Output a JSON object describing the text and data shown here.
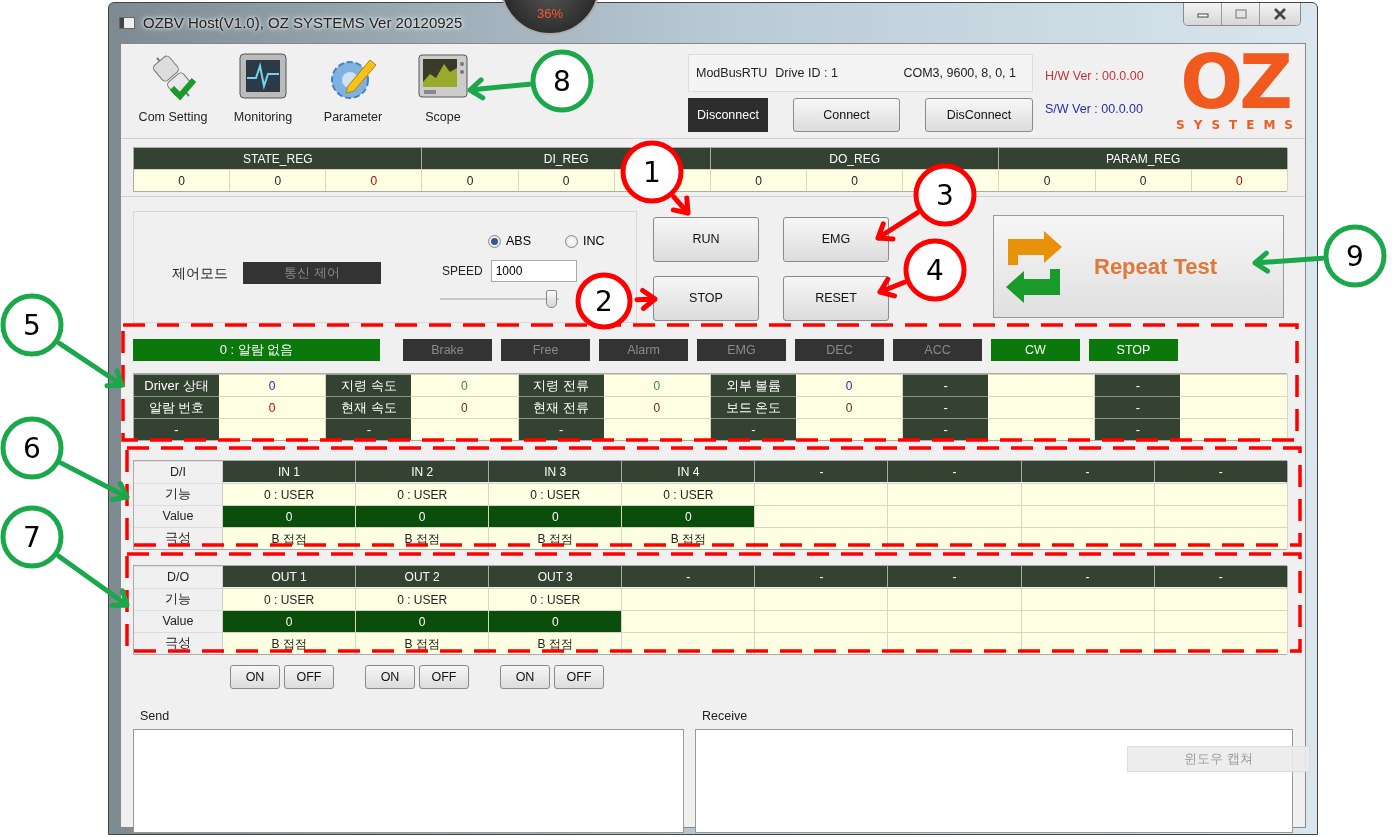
{
  "window": {
    "title": "OZBV Host(V1.0), OZ SYSTEMS Ver 20120925"
  },
  "gauge": {
    "reading": "36%"
  },
  "toolbar": [
    {
      "label": "Com Setting",
      "kind": "plug"
    },
    {
      "label": "Monitoring",
      "kind": "monitor"
    },
    {
      "label": "Parameter",
      "kind": "gear"
    },
    {
      "label": "Scope",
      "kind": "scope"
    }
  ],
  "connection": {
    "protocol": "ModBusRTU",
    "drive_id": "Drive ID : 1",
    "port": "COM3, 9600, 8, 0, 1",
    "status": "Disconnect",
    "buttons": [
      "Connect",
      "DisConnect"
    ]
  },
  "versions": {
    "hw": "H/W Ver : 00.0.00",
    "sw": "S/W Ver : 00.0.00"
  },
  "logo": {
    "mark": "OZ",
    "tagline": "SYSTEMS"
  },
  "registers": [
    {
      "name": "STATE_REG",
      "cells": [
        {
          "value": "0",
          "kind": "plain"
        },
        {
          "value": "0",
          "kind": "plain"
        },
        {
          "value": "0",
          "kind": "alert"
        }
      ]
    },
    {
      "name": "DI_REG",
      "cells": [
        {
          "value": "0",
          "kind": "plain"
        },
        {
          "value": "0",
          "kind": "plain"
        }
      ]
    },
    {
      "name": "DO_REG",
      "cells": [
        {
          "value": "0",
          "kind": "plain"
        },
        {
          "value": "0",
          "kind": "plain"
        }
      ]
    },
    {
      "name": "PARAM_REG",
      "cells": [
        {
          "value": "0",
          "kind": "plain"
        },
        {
          "value": "0",
          "kind": "plain"
        },
        {
          "value": "0",
          "kind": "alert"
        }
      ]
    }
  ],
  "control": {
    "mode_label": "제어모드",
    "mode_value": "통신 제어",
    "modes": [
      {
        "label": "ABS",
        "selected": true
      },
      {
        "label": "INC",
        "selected": false
      }
    ],
    "speed_label": "SPEED",
    "speed_value": "1000",
    "speed_slider": {
      "level": 0.94
    }
  },
  "commands": [
    "RUN",
    "EMG",
    "STOP",
    "RESET"
  ],
  "repeat_test": {
    "label": "Repeat Test"
  },
  "alarm": {
    "text": "0 : 알람 없음"
  },
  "indicators": [
    {
      "label": "Brake",
      "on": false
    },
    {
      "label": "Free",
      "on": false
    },
    {
      "label": "Alarm",
      "on": false
    },
    {
      "label": "EMG",
      "on": false
    },
    {
      "label": "DEC",
      "on": false
    },
    {
      "label": "ACC",
      "on": false
    },
    {
      "label": "CW",
      "on": true
    },
    {
      "label": "STOP",
      "on": true
    }
  ],
  "driver_table": [
    [
      {
        "label": "Driver 상태",
        "value": "0",
        "kind": "state"
      },
      {
        "label": "지령 속도",
        "value": "0",
        "kind": "command"
      },
      {
        "label": "지령 전류",
        "value": "0",
        "kind": "command"
      },
      {
        "label": "외부 볼륨",
        "value": "0",
        "kind": "state"
      },
      {
        "label": "-"
      },
      {
        "label": "-"
      }
    ],
    [
      {
        "label": "알람 번호",
        "value": "0",
        "kind": "alert"
      },
      {
        "label": "현재 속도",
        "value": "0",
        "kind": "feedback"
      },
      {
        "label": "현재 전류",
        "value": "0",
        "kind": "feedback"
      },
      {
        "label": "보드 온도",
        "value": "0",
        "kind": "feedback"
      },
      {
        "label": "-"
      },
      {
        "label": "-"
      }
    ],
    [
      {
        "label": "-"
      },
      {
        "label": "-"
      },
      {
        "label": "-"
      },
      {
        "label": "-"
      },
      {
        "label": "-"
      },
      {
        "label": "-"
      }
    ]
  ],
  "digital_inputs": {
    "corner": "D/I",
    "row_labels": [
      "기능",
      "Value",
      "극성"
    ],
    "channels": [
      {
        "name": "IN 1",
        "function": "0 : USER",
        "value": "0",
        "polarity": "B 접점"
      },
      {
        "name": "IN 2",
        "function": "0 : USER",
        "value": "0",
        "polarity": "B 접점"
      },
      {
        "name": "IN 3",
        "function": "0 : USER",
        "value": "0",
        "polarity": "B 접점"
      },
      {
        "name": "IN 4",
        "function": "0 : USER",
        "value": "0",
        "polarity": "B 접점"
      },
      {
        "name": "-"
      },
      {
        "name": "-"
      },
      {
        "name": "-"
      },
      {
        "name": "-"
      }
    ]
  },
  "digital_outputs": {
    "corner": "D/O",
    "row_labels": [
      "기능",
      "Value",
      "극성"
    ],
    "channels": [
      {
        "name": "OUT 1",
        "function": "0 : USER",
        "value": "0",
        "polarity": "B 접점"
      },
      {
        "name": "OUT 2",
        "function": "0 : USER",
        "value": "0",
        "polarity": "B 접점"
      },
      {
        "name": "OUT 3",
        "function": "0 : USER",
        "value": "0",
        "polarity": "B 접점"
      },
      {
        "name": "-"
      },
      {
        "name": "-"
      },
      {
        "name": "-"
      },
      {
        "name": "-"
      },
      {
        "name": "-"
      }
    ]
  },
  "output_buttons": [
    {
      "on": "ON",
      "off": "OFF"
    },
    {
      "on": "ON",
      "off": "OFF"
    },
    {
      "on": "ON",
      "off": "OFF"
    }
  ],
  "send": {
    "label": "Send"
  },
  "receive": {
    "label": "Receive"
  },
  "capture_overlay": {
    "label": "윈도우 캡쳐"
  },
  "callouts": [
    {
      "number": "1",
      "color": "#ff0000"
    },
    {
      "number": "2",
      "color": "#ff0000"
    },
    {
      "number": "3",
      "color": "#ff0000"
    },
    {
      "number": "4",
      "color": "#ff0000"
    },
    {
      "number": "5",
      "color": "#1aa84a"
    },
    {
      "number": "6",
      "color": "#1aa84a"
    },
    {
      "number": "7",
      "color": "#1aa84a"
    },
    {
      "number": "8",
      "color": "#1aa84a"
    },
    {
      "number": "9",
      "color": "#1aa84a"
    }
  ]
}
